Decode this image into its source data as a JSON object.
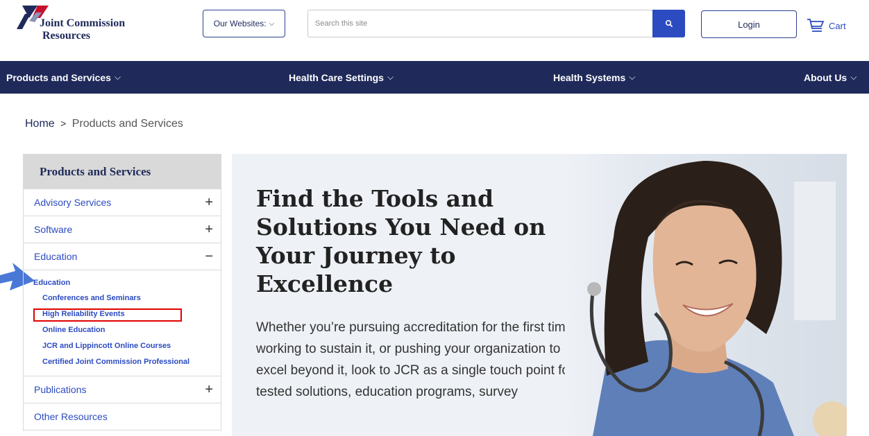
{
  "header": {
    "logo_line1": "Joint Commission",
    "logo_line2": "Resources",
    "websites_label": "Our Websites:",
    "search_placeholder": "Search this site",
    "login_label": "Login",
    "cart_label": "Cart"
  },
  "nav": {
    "items": [
      {
        "label": "Products and Services"
      },
      {
        "label": "Health Care Settings"
      },
      {
        "label": "Health Systems"
      },
      {
        "label": "About Us"
      }
    ]
  },
  "breadcrumb": {
    "home": "Home",
    "separator": ">",
    "current": "Products and Services"
  },
  "sidebar": {
    "title": "Products and Services",
    "items": [
      {
        "label": "Advisory Services",
        "toggle": "+"
      },
      {
        "label": "Software",
        "toggle": "+"
      },
      {
        "label": "Education",
        "toggle": "−"
      },
      {
        "label": "Publications",
        "toggle": "+"
      },
      {
        "label": "Other Resources"
      }
    ],
    "education_sub": {
      "title": "Education",
      "items": [
        "Conferences and Seminars",
        "High Reliability Events",
        "Online Education",
        "JCR and Lippincott Online Courses",
        "Certified Joint Commission Professional"
      ]
    }
  },
  "hero": {
    "title": "Find the Tools and Solutions You Need on Your Journey to Excellence",
    "body": "Whether you’re pursuing accreditation for the first time, working to sustain it, or pushing your organization to excel beyond it, look to JCR as a single touch point for tested solutions, education programs, survey"
  },
  "colors": {
    "navy": "#1f2a5a",
    "link_blue": "#2c4bc0",
    "highlight_red": "#e00000",
    "annotation_arrow": "#4a78d6"
  }
}
